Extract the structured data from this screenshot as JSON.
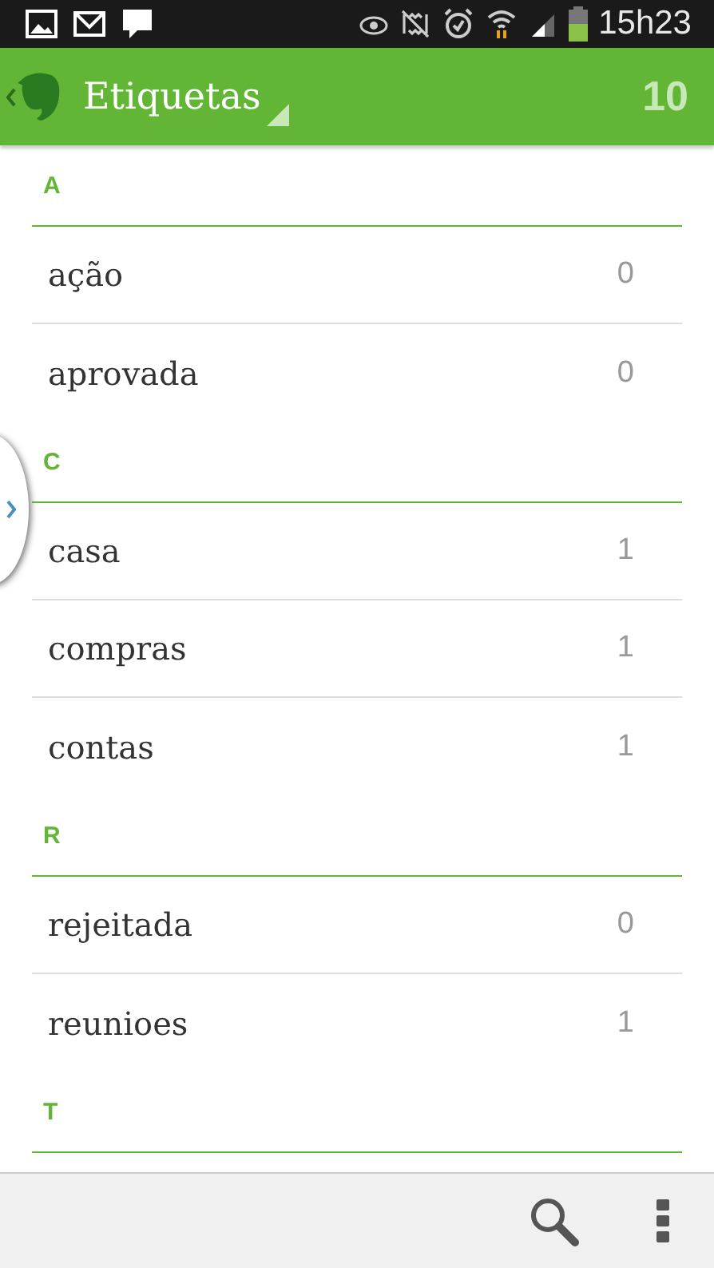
{
  "status_bar": {
    "time": "15h23"
  },
  "header": {
    "title": "Etiquetas",
    "count": "10"
  },
  "sections": [
    {
      "letter": "A",
      "tags": [
        {
          "name": "ação",
          "count": "0"
        },
        {
          "name": "aprovada",
          "count": "0"
        }
      ]
    },
    {
      "letter": "C",
      "tags": [
        {
          "name": "casa",
          "count": "1"
        },
        {
          "name": "compras",
          "count": "1"
        },
        {
          "name": "contas",
          "count": "1"
        }
      ]
    },
    {
      "letter": "R",
      "tags": [
        {
          "name": "rejeitada",
          "count": "0"
        },
        {
          "name": "reunioes",
          "count": "1"
        }
      ]
    },
    {
      "letter": "T"
    }
  ]
}
